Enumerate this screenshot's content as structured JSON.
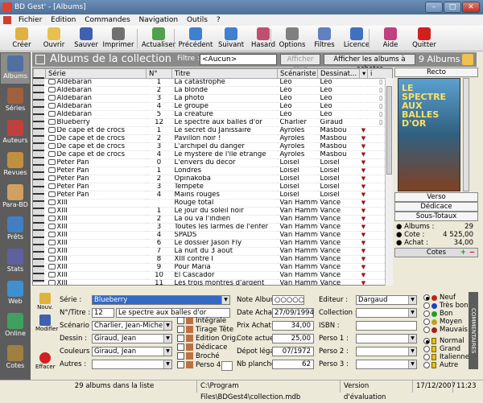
{
  "window": {
    "title": "BD Gest' - [Albums]"
  },
  "menu": [
    "Fichier",
    "Edition",
    "Commandes",
    "Navigation",
    "Outils",
    "?"
  ],
  "toolbar": [
    {
      "label": "Créer",
      "icon": "create-icon",
      "color": "#e0b040"
    },
    {
      "label": "Ouvrir",
      "icon": "open-folder-icon",
      "color": "#e8c050"
    },
    {
      "label": "Sauver",
      "icon": "save-icon",
      "color": "#4060b0"
    },
    {
      "label": "Imprimer",
      "icon": "print-icon",
      "color": "#707070"
    },
    {
      "label": "Actualiser",
      "icon": "refresh-icon",
      "color": "#50a050"
    },
    {
      "label": "Précédent",
      "icon": "arrow-left-icon",
      "color": "#4080d0"
    },
    {
      "label": "Suivant",
      "icon": "arrow-right-icon",
      "color": "#4080d0"
    },
    {
      "label": "Hasard",
      "icon": "random-icon",
      "color": "#c05070"
    },
    {
      "label": "Options",
      "icon": "options-icon",
      "color": "#808080"
    },
    {
      "label": "Filtres",
      "icon": "filter-icon",
      "color": "#6080c0"
    },
    {
      "label": "Licence",
      "icon": "licence-icon",
      "color": "#4070c0"
    },
    {
      "label": "Aide",
      "icon": "help-book-icon",
      "color": "#c04080"
    },
    {
      "label": "Quitter",
      "icon": "quit-icon",
      "color": "#d02020"
    }
  ],
  "sidebar": [
    {
      "label": "Albums",
      "icon": "albums-icon",
      "color": "#5070a0",
      "selected": true
    },
    {
      "label": "Séries",
      "icon": "series-icon",
      "color": "#a06040"
    },
    {
      "label": "Auteurs",
      "icon": "authors-icon",
      "color": "#c04040"
    },
    {
      "label": "Revues",
      "icon": "magazines-icon",
      "color": "#c09040"
    },
    {
      "label": "Para-BD",
      "icon": "para-bd-icon",
      "color": "#d0a060"
    },
    {
      "label": "Prêts",
      "icon": "loans-icon",
      "color": "#4080c0"
    },
    {
      "label": "Stats",
      "icon": "stats-icon",
      "color": "#6060a0"
    },
    {
      "label": "Web",
      "icon": "web-globe-icon",
      "color": "#4090d0"
    },
    {
      "label": "Online",
      "icon": "online-globe-icon",
      "color": "#40a060"
    },
    {
      "label": "Cotes",
      "icon": "cotes-icon",
      "color": "#a08040"
    }
  ],
  "header": {
    "title": "Albums de la collection",
    "filter_label": "Filtre :",
    "filter_value": "<Aucun>",
    "show_all": "Afficher tout",
    "show_to_buy": "Afficher les albums à acheter",
    "count": "9 Albums"
  },
  "table": {
    "columns": [
      "Série",
      "N°",
      "Titre",
      "Scénariste",
      "Dessinat..."
    ],
    "rows": [
      [
        "Aldébaran",
        "1",
        "La catastrophe",
        "Léo",
        "Léo",
        "doc"
      ],
      [
        "Aldébaran",
        "2",
        "La blonde",
        "Léo",
        "Léo",
        "doc"
      ],
      [
        "Aldébaran",
        "3",
        "La photo",
        "Léo",
        "Léo",
        "doc"
      ],
      [
        "Aldébaran",
        "4",
        "Le groupe",
        "Léo",
        "Léo",
        "doc"
      ],
      [
        "Aldébaran",
        "5",
        "La créature",
        "Léo",
        "Léo",
        "doc"
      ],
      [
        "Blueberry",
        "12",
        "Le spectre aux balles d'or",
        "Charlier",
        "Giraud",
        "doc"
      ],
      [
        "De cape et de crocs",
        "1",
        "Le secret du Janissaire",
        "Ayroles",
        "Masbou",
        "mark"
      ],
      [
        "De cape et de crocs",
        "2",
        "Pavillon noir !",
        "Ayroles",
        "Masbou",
        "mark"
      ],
      [
        "De cape et de crocs",
        "3",
        "L'archipel du danger",
        "Ayroles",
        "Masbou",
        "mark"
      ],
      [
        "De cape et de crocs",
        "4",
        "Le mystère de l'île étrange",
        "Ayroles",
        "Masbou",
        "mark"
      ],
      [
        "Peter Pan",
        "0",
        "L'envers du décor",
        "Loisel",
        "Loisel",
        "mark"
      ],
      [
        "Peter Pan",
        "1",
        "Londres",
        "Loisel",
        "Loisel",
        "mark"
      ],
      [
        "Peter Pan",
        "2",
        "Opinakoba",
        "Loisel",
        "Loisel",
        "mark"
      ],
      [
        "Peter Pan",
        "3",
        "Tempête",
        "Loisel",
        "Loisel",
        "mark"
      ],
      [
        "Peter Pan",
        "4",
        "Mains rouges",
        "Loisel",
        "Loisel",
        "mark"
      ],
      [
        "XIII",
        "",
        "Rouge total",
        "Van Hamme",
        "Vance",
        "mark"
      ],
      [
        "XIII",
        "1",
        "Le jour du soleil noir",
        "Van Hamme",
        "Vance",
        "mark"
      ],
      [
        "XIII",
        "2",
        "Là où va l'indien",
        "Van Hamme",
        "Vance",
        "mark"
      ],
      [
        "XIII",
        "3",
        "Toutes les larmes de l'enfer",
        "Van Hamme",
        "Vance",
        "mark"
      ],
      [
        "XIII",
        "4",
        "SPADS",
        "Van Hamme",
        "Vance",
        "mark"
      ],
      [
        "XIII",
        "6",
        "Le dossier Jason Fly",
        "Van Hamme",
        "Vance",
        "mark"
      ],
      [
        "XIII",
        "7",
        "La nuit du 3 août",
        "Van Hamme",
        "Vance",
        "mark"
      ],
      [
        "XIII",
        "8",
        "XIII contre I",
        "Van Hamme",
        "Vance",
        "mark"
      ],
      [
        "XIII",
        "9",
        "Pour Maria",
        "Van Hamme",
        "Vance",
        "mark"
      ],
      [
        "XIII",
        "10",
        "El Cascador",
        "Van Hamme",
        "Vance",
        "mark"
      ],
      [
        "XIII",
        "11",
        "Les trois montres d'argent",
        "Van Hamme",
        "Vance",
        "mark"
      ]
    ]
  },
  "cover": {
    "title_text": "LE SPECTRE AUX BALLES D'OR"
  },
  "right_panel": {
    "recto": "Recto",
    "verso": "Verso",
    "dedicace": "Dédicace",
    "sous_totaux": "Sous-Totaux",
    "albums_label": "Albums :",
    "albums_value": "29",
    "cote_label": "Cote :",
    "cote_value": "4 525,00",
    "achat_label": "Achat :",
    "achat_value": "34,00",
    "cotes": "Cotes"
  },
  "detail": {
    "nouv": "Nouv.",
    "modifier": "Modifier",
    "effacer": "Effacer",
    "serie_label": "Série :",
    "serie_value": "Blueberry",
    "ntitre_label": "N°/Titre :",
    "num_value": "12",
    "titre_value": "Le spectre aux balles d'or",
    "scenario_label": "Scénario :",
    "scenario_value": "Charlier, Jean-Michel",
    "dessin_label": "Dessin :",
    "dessin_value": "Giraud, Jean",
    "couleurs_label": "Couleurs :",
    "couleurs_value": "Giraud, Jean",
    "autres_label": "Autres :",
    "checks": [
      "Intégrale",
      "Tirage Tête",
      "Edition Orig.",
      "Dédicace",
      "Broché",
      "Perso 4 :"
    ],
    "note_label": "Note Album :",
    "date_achat_label": "Date Achat :",
    "date_achat_value": "27/09/1994",
    "prix_achat_label": "Prix Achat :",
    "prix_achat_value": "34,00",
    "cote_actuelle_label": "Cote actuelle :",
    "cote_actuelle_value": "25,00",
    "depot_legal_label": "Dépot légal :",
    "depot_legal_value": "07/1972",
    "nb_planches_label": "Nb planches :",
    "nb_planches_value": "62",
    "editeur_label": "Editeur :",
    "editeur_value": "Dargaud",
    "collection_label": "Collection :",
    "isbn_label": "ISBN :",
    "perso1_label": "Perso 1 :",
    "perso2_label": "Perso 2 :",
    "perso3_label": "Perso 3 :",
    "etat": [
      "Neuf",
      "Très bon",
      "Bon",
      "Moyen",
      "Mauvais"
    ],
    "format": [
      "Normal",
      "Grand",
      "Italienne",
      "Autre"
    ],
    "vertical_tab": "COMMENTAIRES"
  },
  "status": {
    "count": "29 albums dans la liste",
    "path": "C:\\Program Files\\BDGest4\\collection.mdb",
    "version": "Version d'évaluation",
    "date": "17/12/2007",
    "time": "11:23"
  }
}
